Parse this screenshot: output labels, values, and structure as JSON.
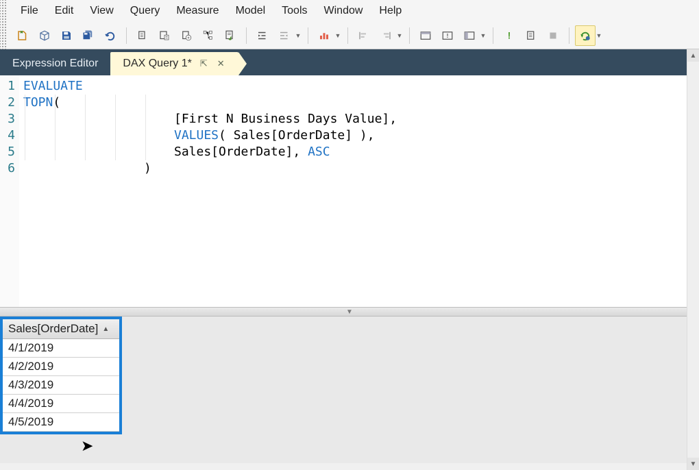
{
  "menu": {
    "items": [
      "File",
      "Edit",
      "View",
      "Query",
      "Measure",
      "Model",
      "Tools",
      "Window",
      "Help"
    ]
  },
  "toolbar": {
    "icons": [
      "new-query-icon",
      "cube-icon",
      "save-icon",
      "save-all-icon",
      "undo-icon",
      "sep",
      "copy-icon",
      "paste-special-icon",
      "paste-icon",
      "tree-icon",
      "format-icon",
      "sep",
      "indent-icon",
      "outdent-icon",
      "sep",
      "chart-icon",
      "sep",
      "align-left-icon",
      "align-right-icon",
      "sep",
      "panel-icon",
      "panel-alert-icon",
      "panel-settings-icon",
      "sep",
      "exclaim-icon",
      "doc-icon",
      "stop-icon",
      "sep",
      "run-gear-icon"
    ]
  },
  "tabs": {
    "inactive": "Expression Editor",
    "active": "DAX Query 1*"
  },
  "code": {
    "lines": [
      "1",
      "2",
      "3",
      "4",
      "5",
      "6"
    ],
    "l1_kw": "EVALUATE",
    "l2_kw": "TOPN",
    "l2_rest": "(",
    "l3": "[First N Business Days Value],",
    "l4_kw": "VALUES",
    "l4_rest": "( Sales[OrderDate] ),",
    "l5_a": "Sales[OrderDate], ",
    "l5_kw": "ASC",
    "l6": ")"
  },
  "results": {
    "header": "Sales[OrderDate]",
    "rows": [
      "4/1/2019",
      "4/2/2019",
      "4/3/2019",
      "4/4/2019",
      "4/5/2019"
    ]
  }
}
